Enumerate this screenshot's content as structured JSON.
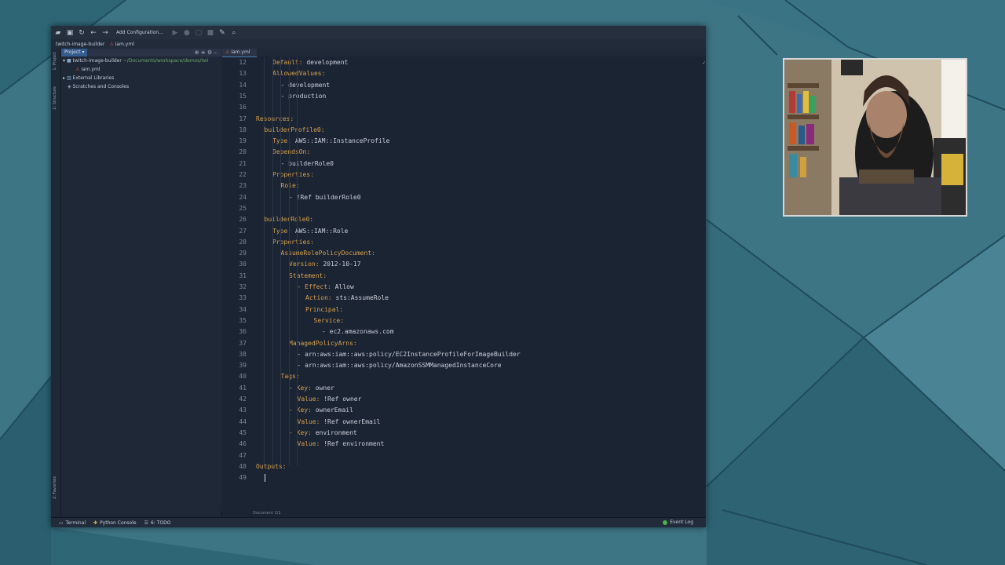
{
  "toolbar": {
    "add_configuration": "Add Configuration..."
  },
  "navbar": {
    "project_name": "twitch-image-builder",
    "file_name": "iam.yml"
  },
  "side_strip": {
    "project_tab": "1: Project",
    "structure_tab": "2: Structure",
    "favorites_tab": "2: Favorites"
  },
  "project_panel": {
    "view_selector": "Project",
    "tree": [
      {
        "label": "twitch-image-builder",
        "path": "~/Documents/workspace/demos/twi"
      },
      {
        "label": "iam.yml",
        "path": ""
      },
      {
        "label": "External Libraries",
        "path": ""
      },
      {
        "label": "Scratches and Consoles",
        "path": ""
      }
    ]
  },
  "editor": {
    "tab_label": "iam.yml",
    "status": "Document 1/1",
    "lines": [
      {
        "n": "12",
        "indent": 2,
        "key": "Default:",
        "val": " development"
      },
      {
        "n": "13",
        "indent": 2,
        "key": "AllowedValues:",
        "val": ""
      },
      {
        "n": "14",
        "indent": 3,
        "key": "",
        "val": "- development"
      },
      {
        "n": "15",
        "indent": 3,
        "key": "",
        "val": "- production"
      },
      {
        "n": "16",
        "indent": 0,
        "key": "",
        "val": ""
      },
      {
        "n": "17",
        "indent": 0,
        "key": "Resources:",
        "val": ""
      },
      {
        "n": "18",
        "indent": 1,
        "key": "builderProfile0:",
        "val": ""
      },
      {
        "n": "19",
        "indent": 2,
        "key": "Type:",
        "val": " AWS::IAM::InstanceProfile"
      },
      {
        "n": "20",
        "indent": 2,
        "key": "DependsOn:",
        "val": ""
      },
      {
        "n": "21",
        "indent": 3,
        "key": "",
        "val": "- builderRole0"
      },
      {
        "n": "22",
        "indent": 2,
        "key": "Properties:",
        "val": ""
      },
      {
        "n": "23",
        "indent": 3,
        "key": "Role:",
        "val": ""
      },
      {
        "n": "24",
        "indent": 4,
        "key": "",
        "val": "- !Ref builderRole0"
      },
      {
        "n": "25",
        "indent": 0,
        "key": "",
        "val": ""
      },
      {
        "n": "26",
        "indent": 1,
        "key": "builderRole0:",
        "val": ""
      },
      {
        "n": "27",
        "indent": 2,
        "key": "Type:",
        "val": " AWS::IAM::Role"
      },
      {
        "n": "28",
        "indent": 2,
        "key": "Properties:",
        "val": ""
      },
      {
        "n": "29",
        "indent": 3,
        "key": "AssumeRolePolicyDocument:",
        "val": ""
      },
      {
        "n": "30",
        "indent": 4,
        "key": "Version:",
        "val": " 2012-10-17"
      },
      {
        "n": "31",
        "indent": 4,
        "key": "Statement:",
        "val": ""
      },
      {
        "n": "32",
        "indent": 5,
        "key": "- Effect:",
        "val": " Allow"
      },
      {
        "n": "33",
        "indent": 6,
        "key": "Action:",
        "val": " sts:AssumeRole"
      },
      {
        "n": "34",
        "indent": 6,
        "key": "Principal:",
        "val": ""
      },
      {
        "n": "35",
        "indent": 7,
        "key": "Service:",
        "val": ""
      },
      {
        "n": "36",
        "indent": 8,
        "key": "",
        "val": "- ec2.amazonaws.com"
      },
      {
        "n": "37",
        "indent": 4,
        "key": "ManagedPolicyArns:",
        "val": ""
      },
      {
        "n": "38",
        "indent": 5,
        "key": "",
        "val": "- arn:aws:iam::aws:policy/EC2InstanceProfileForImageBuilder"
      },
      {
        "n": "39",
        "indent": 5,
        "key": "",
        "val": "- arn:aws:iam::aws:policy/AmazonSSMManagedInstanceCore"
      },
      {
        "n": "40",
        "indent": 3,
        "key": "Tags:",
        "val": ""
      },
      {
        "n": "41",
        "indent": 4,
        "key": "- Key:",
        "val": " owner"
      },
      {
        "n": "42",
        "indent": 5,
        "key": "Value:",
        "val": " !Ref owner"
      },
      {
        "n": "43",
        "indent": 4,
        "key": "- Key:",
        "val": " ownerEmail"
      },
      {
        "n": "44",
        "indent": 5,
        "key": "Value:",
        "val": " !Ref ownerEmail"
      },
      {
        "n": "45",
        "indent": 4,
        "key": "- Key:",
        "val": " environment"
      },
      {
        "n": "46",
        "indent": 5,
        "key": "Value:",
        "val": " !Ref environment"
      },
      {
        "n": "47",
        "indent": 0,
        "key": "",
        "val": ""
      },
      {
        "n": "48",
        "indent": 0,
        "key": "Outputs:",
        "val": ""
      },
      {
        "n": "49",
        "indent": 1,
        "key": "",
        "val": ""
      }
    ]
  },
  "bottom_bar": {
    "terminal": "Terminal",
    "python_console": "Python Console",
    "todo": "6: TODO",
    "event_log": "Event Log"
  },
  "colors": {
    "background": "#3d7585",
    "editor_bg": "#1b2433",
    "yaml_key": "#d6a04d",
    "text": "#c9cfd8",
    "line_numbers": "#7d8695"
  }
}
